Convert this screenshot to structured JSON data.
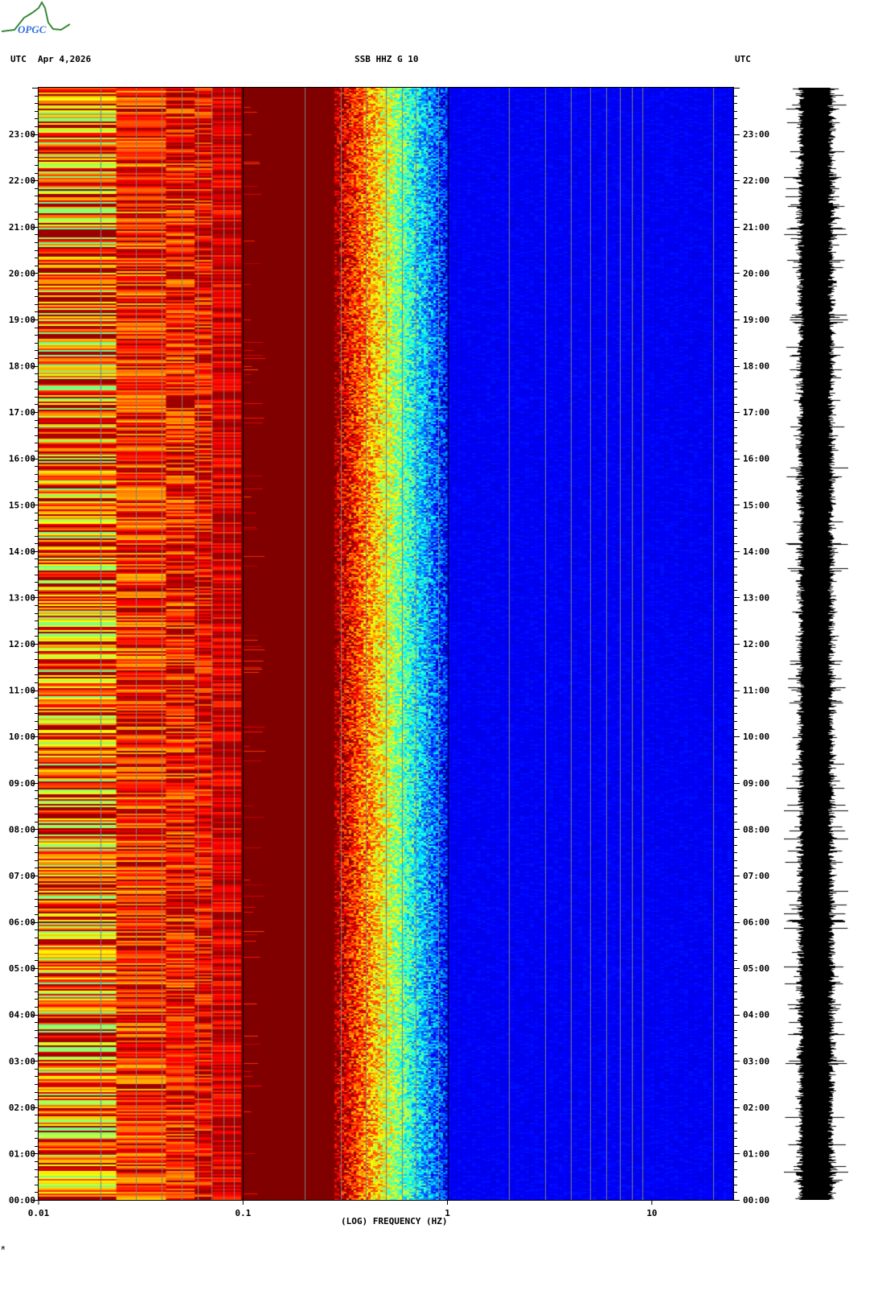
{
  "header": {
    "utc_left": "UTC",
    "date": "Apr 4,2026",
    "station": "SSB HHZ G 10",
    "utc_right": "UTC"
  },
  "logo": {
    "text": "OPGC"
  },
  "footer_mark": "M",
  "colors": {
    "background_low": "#0000a0",
    "high": "#800000",
    "grid": "#808080"
  },
  "chart_data": {
    "type": "heatmap",
    "title": "SSB HHZ G 10",
    "xlabel": "(LOG) FREQUENCY (HZ)",
    "x_scale": "log",
    "xlim": [
      0.01,
      25
    ],
    "x_ticks": [
      {
        "value": 0.01,
        "label": "0.01"
      },
      {
        "value": 0.1,
        "label": "0.1"
      },
      {
        "value": 1,
        "label": "1"
      },
      {
        "value": 10,
        "label": "10"
      }
    ],
    "ylabel": "UTC",
    "ylim_hours": [
      0,
      24
    ],
    "y_ticks": [
      "00:00",
      "01:00",
      "02:00",
      "03:00",
      "04:00",
      "05:00",
      "06:00",
      "07:00",
      "08:00",
      "09:00",
      "10:00",
      "11:00",
      "12:00",
      "13:00",
      "14:00",
      "15:00",
      "16:00",
      "17:00",
      "18:00",
      "19:00",
      "20:00",
      "21:00",
      "22:00",
      "23:00"
    ],
    "minor_tick_minutes": 10,
    "colormap": "jet",
    "bands": [
      {
        "fmin": 0.01,
        "fmax": 0.024,
        "level": "high-variable (yellow/orange/cyan)"
      },
      {
        "fmin": 0.024,
        "fmax": 0.1,
        "level": "high (red/orange)"
      },
      {
        "fmin": 0.1,
        "fmax": 0.3,
        "level": "saturated (dark red)"
      },
      {
        "fmin": 0.3,
        "fmax": 0.5,
        "level": "transition (red to cyan)"
      },
      {
        "fmin": 0.5,
        "fmax": 0.9,
        "level": "medium (cyan/blue)"
      },
      {
        "fmin": 0.9,
        "fmax": 25,
        "level": "low (dark blue)"
      }
    ]
  }
}
